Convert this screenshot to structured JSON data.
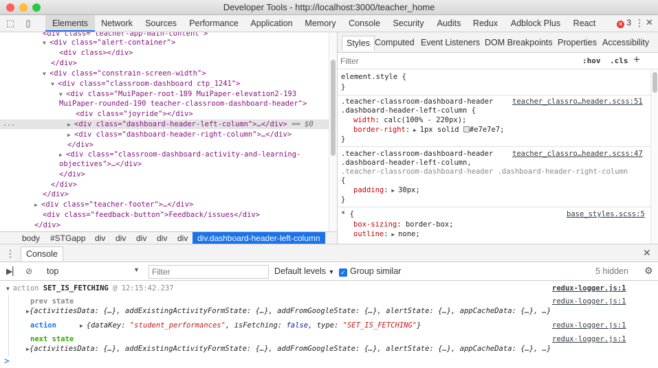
{
  "window": {
    "title": "Developer Tools - http://localhost:3000/teacher_home"
  },
  "tabs": [
    "Elements",
    "Network",
    "Sources",
    "Performance",
    "Application",
    "Memory",
    "Console",
    "Security",
    "Audits",
    "Redux",
    "Adblock Plus",
    "React"
  ],
  "active_tab": "Elements",
  "error_count": "3",
  "dom": {
    "line0": "div class=\"teacher-app-main-content\">",
    "alert_open": "<div class=\"alert-container\">",
    "alert_inner": "<div class></div>",
    "close_div": "</div>",
    "constrain": "<div class=\"constrain-screen-width\">",
    "dashboard": "<div class=\"classroom-dashboard ctp_1241\">",
    "paper1": "<div class=\"MuiPaper-root-189 MuiPaper-elevation2-193",
    "paper2": "MuiPaper-rounded-190 teacher-classroom-dashboard-header\">",
    "joyride": "<div class=\"joyride\"></div>",
    "left_col": "<div class=\"dashboard-header-left-column\">…</div>",
    "left_col_eq": "== $0",
    "right_col": "<div class=\"dashboard-header-right-column\">…</div>",
    "activity1": "<div class=\"classroom-dashboard-activity-and-learning-",
    "activity2": "objectives\">…</div>",
    "footer": "<div class=\"teacher-footer\">…</div>",
    "feedback": "<div class=\"feedback-button\">Feedback/issues</div>",
    "dots": "..."
  },
  "breadcrumbs": [
    "body",
    "#STGapp",
    "div",
    "div",
    "div",
    "div",
    "div",
    "div.dashboard-header-left-column"
  ],
  "styles": {
    "tabs": [
      "Styles",
      "Computed",
      "Event Listeners",
      "DOM Breakpoints",
      "Properties",
      "Accessibility"
    ],
    "filter_placeholder": "Filter",
    "hov": ":hov",
    "cls": ".cls",
    "plus": "+",
    "element_style": "element.style {",
    "close_brace": "}",
    "rule1_sel1": ".teacher-classroom-dashboard-header",
    "rule1_sel2": ".dashboard-header-left-column {",
    "rule1_src": "teacher_classro…header.scss:51",
    "rule1_p1_name": "width",
    "rule1_p1_val": "calc(100% - 220px);",
    "rule1_p2_name": "border-right",
    "rule1_p2_val": "1px solid",
    "rule1_p2_color": "#e7e7e7;",
    "rule2_sel1": ".teacher-classroom-dashboard-header",
    "rule2_sel2": ".dashboard-header-left-column,",
    "rule2_sel3": ".teacher-classroom-dashboard-header .dashboard-header-right-column",
    "rule2_open": "{",
    "rule2_src": "teacher_classro…header.scss:47",
    "rule2_p1_name": "padding",
    "rule2_p1_val": "30px;",
    "rule3_sel": "* {",
    "rule3_src": "base_styles.scss:5",
    "rule3_p1_name": "box-sizing",
    "rule3_p1_val": "border-box;",
    "rule3_p2_name": "outline",
    "rule3_p2_val": "none;"
  },
  "drawer": {
    "tab": "Console"
  },
  "console_toolbar": {
    "context": "top",
    "filter_placeholder": "Filter",
    "levels": "Default levels",
    "group_similar": "Group similar",
    "hidden": "5 hidden"
  },
  "console": {
    "header_action": "action",
    "header_type": "SET_IS_FETCHING",
    "header_at": "@ 12:15:42.237",
    "source": "redux-logger.js:1",
    "prev_label": "prev state",
    "prev_value": "{activitiesData: {…}, addExistingActivityFormState: {…}, addFromGoogleState: {…}, alertState: {…}, appCacheData: {…}, …}",
    "action_label": "action",
    "action_open": "{dataKey: ",
    "action_datakey": "\"student_performances\"",
    "action_mid": ", isFetching: ",
    "action_false": "false",
    "action_mid2": ", type: ",
    "action_type": "\"SET_IS_FETCHING\"",
    "action_close": "}",
    "next_label": "next state",
    "next_value": "{activitiesData: {…}, addExistingActivityFormState: {…}, addFromGoogleState: {…}, alertState: {…}, appCacheData: {…}, …}",
    "prompt": ">"
  },
  "colors": {
    "accent": "#1a73e8",
    "error": "#e53935",
    "property": "#c80000"
  }
}
